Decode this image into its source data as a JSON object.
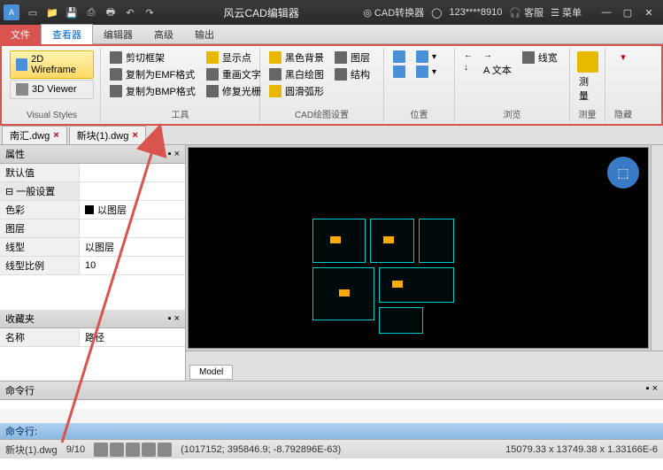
{
  "titlebar": {
    "app_title": "风云CAD编辑器",
    "converter": "CAD转换器",
    "user_id": "123****8910",
    "support": "客服",
    "menu": "菜单"
  },
  "menu": {
    "file": "文件",
    "viewer": "查看器",
    "editor": "编辑器",
    "advanced": "高级",
    "output": "输出"
  },
  "ribbon": {
    "visual_styles": {
      "wireframe_2d": "2D Wireframe",
      "viewer_3d": "3D Viewer",
      "label": "Visual Styles"
    },
    "tools": {
      "clip_frame": "剪切框架",
      "copy_emf": "复制为EMF格式",
      "copy_bmp": "复制为BMP格式",
      "show_points": "显示点",
      "redraw_text": "重画文字",
      "repair_trace": "修复光栅",
      "label": "工具"
    },
    "cad_settings": {
      "black_bg": "黑色背景",
      "bw_draw": "黑白绘图",
      "smooth_arc": "圆滑弧形",
      "layers": "图层",
      "structure": "结构",
      "label": "CAD绘图设置"
    },
    "position": {
      "label": "位置"
    },
    "browse": {
      "lineweight": "线宽",
      "text": "A 文本",
      "label": "浏览"
    },
    "measure": {
      "btn": "测量",
      "label": "测量"
    },
    "hide": {
      "label": "隐藏"
    }
  },
  "doctabs": {
    "tab1": "南汇.dwg",
    "tab2": "新块(1).dwg"
  },
  "props": {
    "header": "属性",
    "default": "默认值",
    "general": "一般设置",
    "color": "色彩",
    "color_val": "以图层",
    "layer": "图层",
    "linetype": "线型",
    "linetype_val": "以图层",
    "lscale": "线型比例",
    "lscale_val": "10"
  },
  "fav": {
    "header": "收藏夹",
    "name": "名称",
    "path": "路径"
  },
  "canvas": {
    "model_tab": "Model"
  },
  "cmdline": {
    "header": "命令行",
    "prompt": "命令行:"
  },
  "statusbar": {
    "file": "新块(1).dwg",
    "progress": "9/10",
    "coords": "(1017152; 395846.9; -8.792896E-63)",
    "dims": "15079.33 x 13749.38 x 1.33166E-6"
  }
}
